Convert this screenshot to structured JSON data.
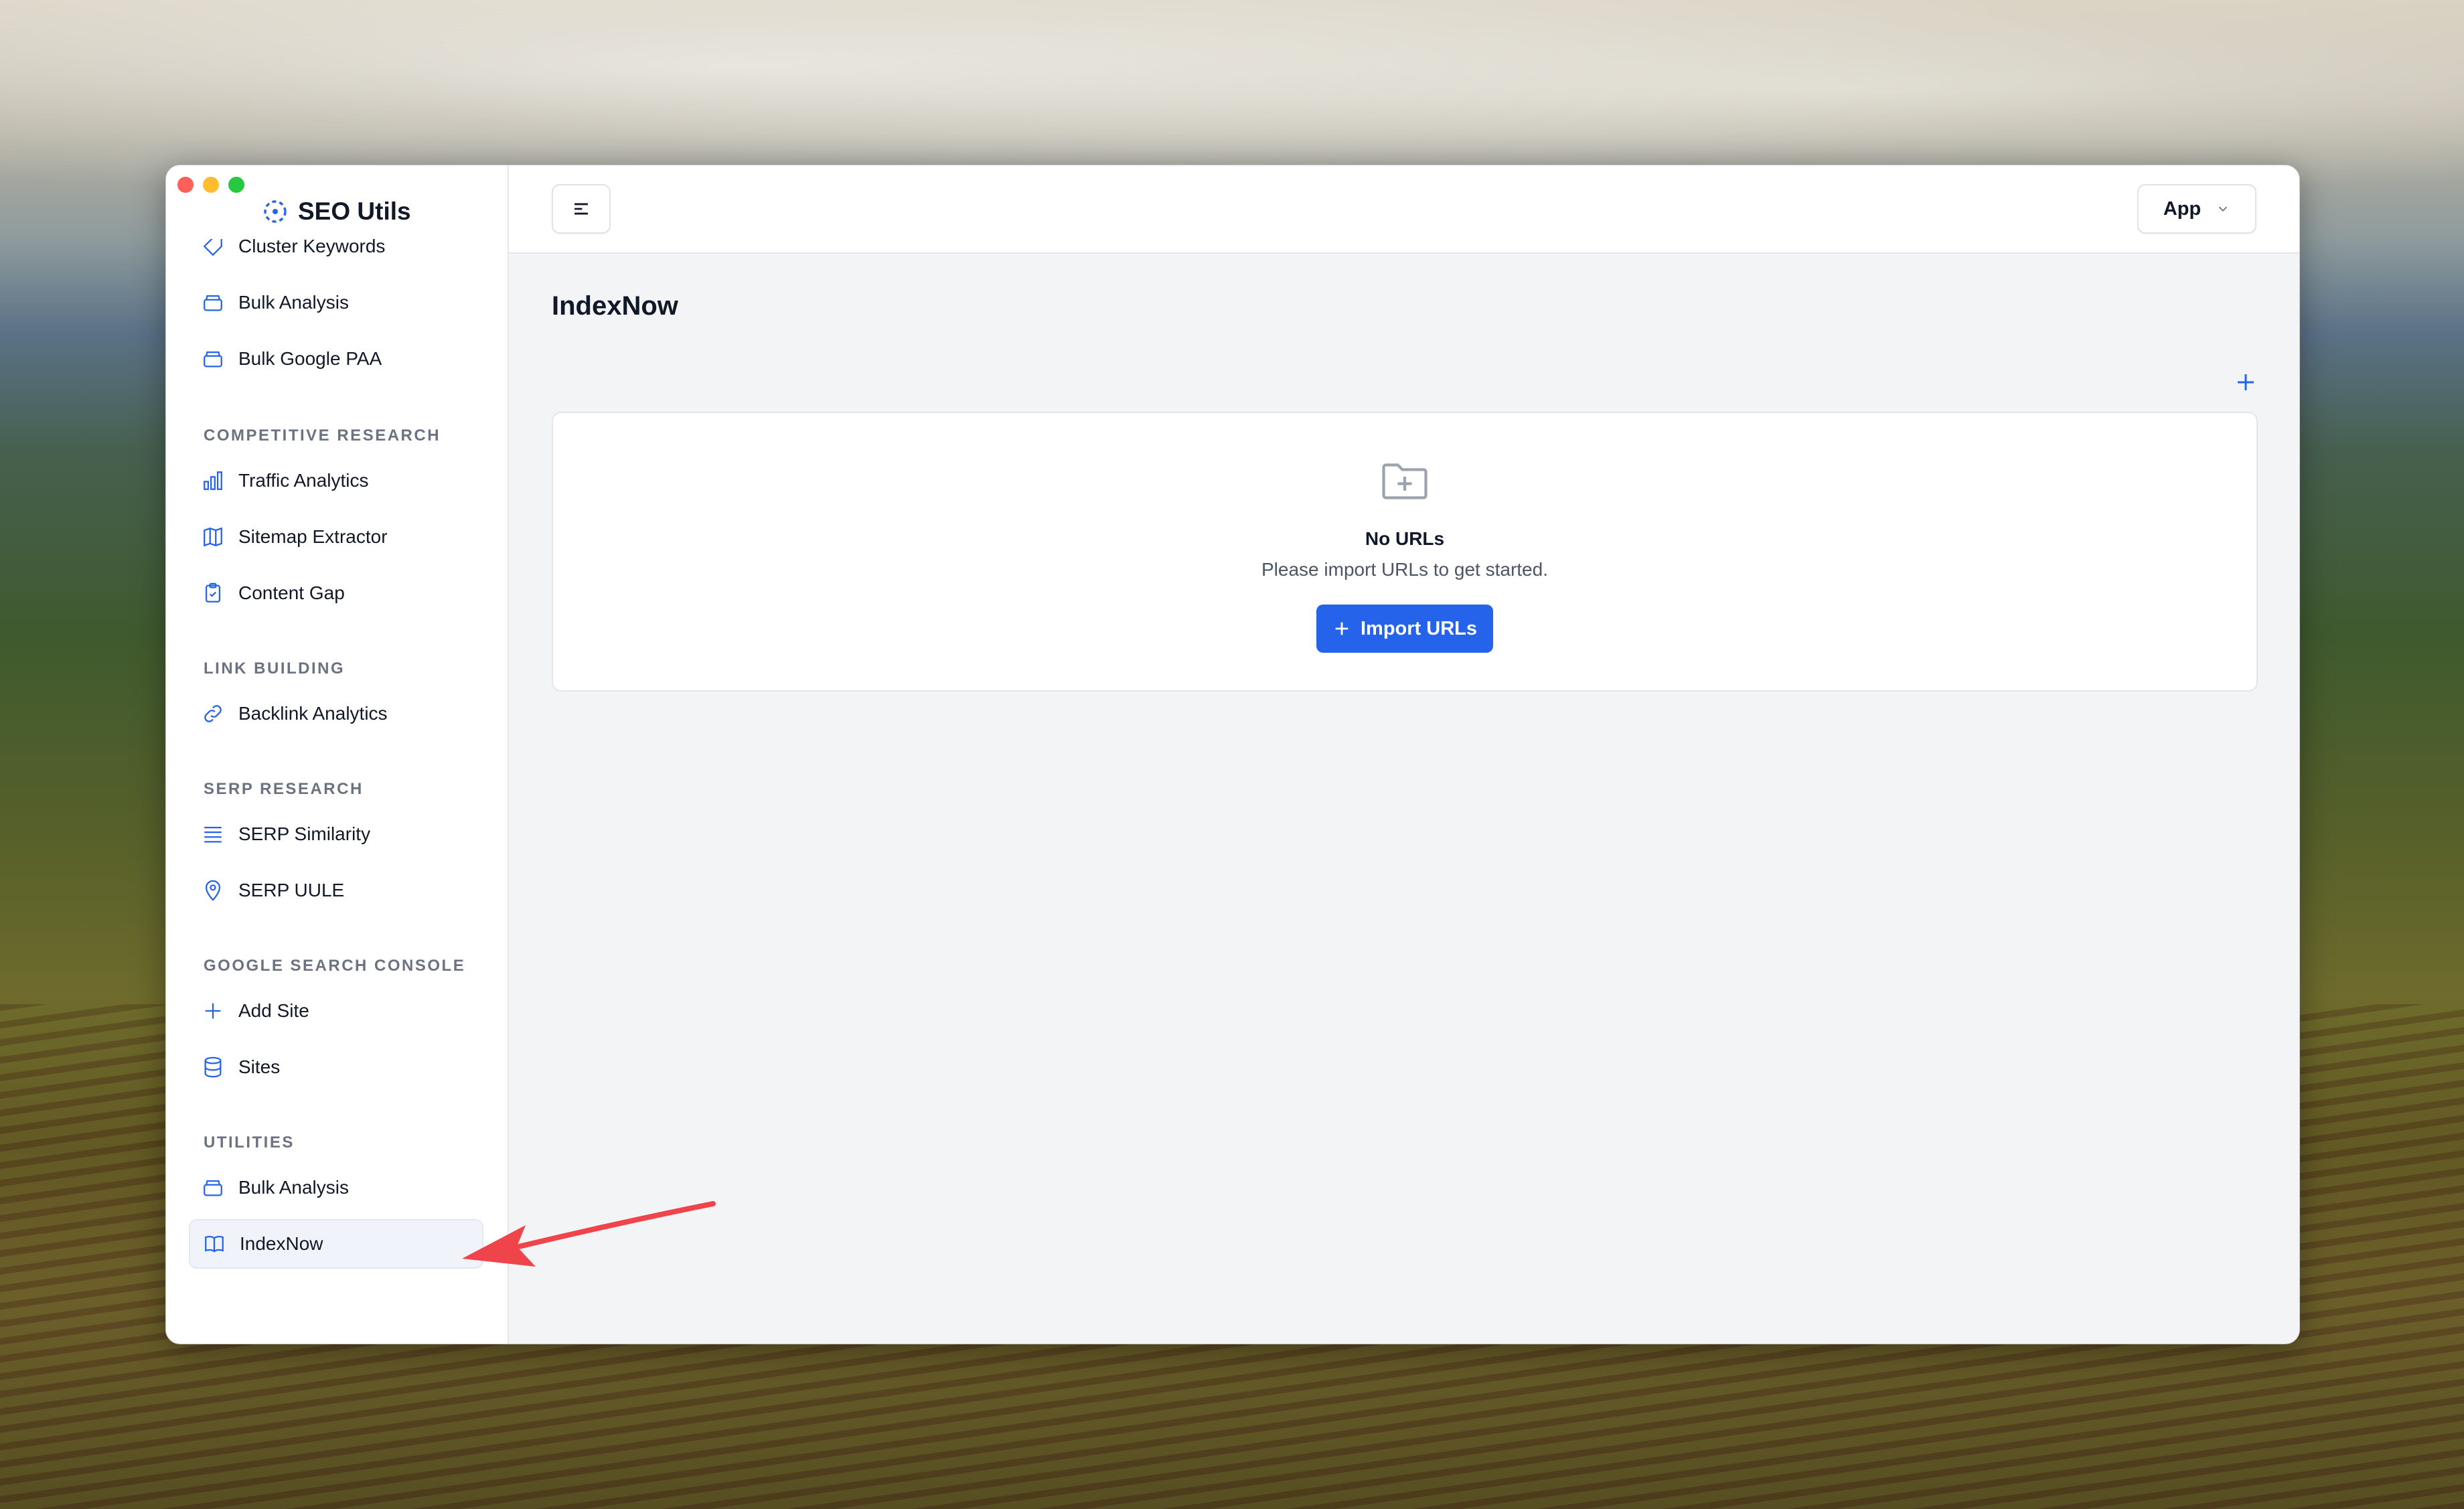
{
  "app": {
    "brand": "SEO Utils"
  },
  "sidebar": {
    "items": [
      {
        "label": "Cluster Keywords",
        "icon": "tag-icon"
      },
      {
        "label": "Bulk Analysis",
        "icon": "stack-icon"
      },
      {
        "label": "Bulk Google PAA",
        "icon": "stack-icon"
      }
    ],
    "sections": [
      {
        "title": "COMPETITIVE RESEARCH",
        "items": [
          {
            "label": "Traffic Analytics",
            "icon": "bar-chart-icon"
          },
          {
            "label": "Sitemap Extractor",
            "icon": "map-icon"
          },
          {
            "label": "Content Gap",
            "icon": "clipboard-check-icon"
          }
        ]
      },
      {
        "title": "LINK BUILDING",
        "items": [
          {
            "label": "Backlink Analytics",
            "icon": "link-icon"
          }
        ]
      },
      {
        "title": "SERP RESEARCH",
        "items": [
          {
            "label": "SERP Similarity",
            "icon": "list-icon"
          },
          {
            "label": "SERP UULE",
            "icon": "map-pin-icon"
          }
        ]
      },
      {
        "title": "GOOGLE SEARCH CONSOLE",
        "items": [
          {
            "label": "Add Site",
            "icon": "plus-icon"
          },
          {
            "label": "Sites",
            "icon": "database-icon"
          }
        ]
      },
      {
        "title": "UTILITIES",
        "items": [
          {
            "label": "Bulk Analysis",
            "icon": "stack-icon"
          },
          {
            "label": "IndexNow",
            "icon": "book-icon",
            "active": true
          }
        ]
      }
    ]
  },
  "header": {
    "app_selector": "App"
  },
  "main": {
    "title": "IndexNow",
    "empty_state": {
      "title": "No URLs",
      "description": "Please import URLs to get started.",
      "button": "Import URLs"
    }
  },
  "colors": {
    "accent": "#2563eb",
    "annotation_arrow": "#f0444b"
  }
}
